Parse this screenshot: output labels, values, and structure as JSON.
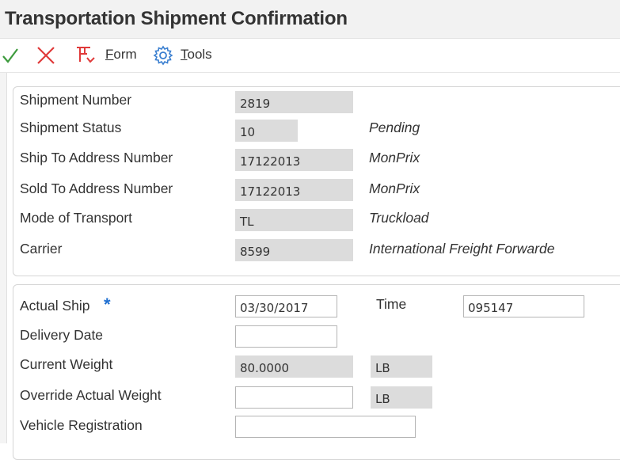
{
  "header": {
    "title": "Transportation Shipment Confirmation"
  },
  "toolbar": {
    "ok_icon": "checkmark-icon",
    "cancel_icon": "close-icon",
    "form_label_first": "F",
    "form_label_rest": "orm",
    "tools_label_first": "T",
    "tools_label_rest": "ools"
  },
  "shipment_info": {
    "fields": [
      {
        "label": "Shipment Number",
        "value": "2819",
        "description": ""
      },
      {
        "label": "Shipment Status",
        "value": "10",
        "description": "Pending"
      },
      {
        "label": "Ship To Address Number",
        "value": "17122013",
        "description": "MonPrix"
      },
      {
        "label": "Sold To Address Number",
        "value": "17122013",
        "description": "MonPrix"
      },
      {
        "label": "Mode of Transport",
        "value": "TL",
        "description": "Truckload"
      },
      {
        "label": "Carrier",
        "value": "8599",
        "description": "International Freight Forwarde"
      }
    ]
  },
  "confirmation": {
    "actual_ship_label": "Actual Ship",
    "actual_ship_date": "03/30/2017",
    "time_label": "Time",
    "time_value": "095147",
    "delivery_date_label": "Delivery Date",
    "delivery_date_value": "",
    "current_weight_label": "Current Weight",
    "current_weight_value": "80.0000",
    "current_weight_uom": "LB",
    "override_weight_label": "Override Actual Weight",
    "override_weight_value": "",
    "override_weight_uom": "LB",
    "vehicle_registration_label": "Vehicle Registration",
    "vehicle_registration_value": ""
  },
  "colors": {
    "ok_green": "#3d9b3d",
    "cancel_red": "#e03a3a",
    "required_blue": "#1f6fd1",
    "readonly_bg": "#dcdcdc"
  }
}
